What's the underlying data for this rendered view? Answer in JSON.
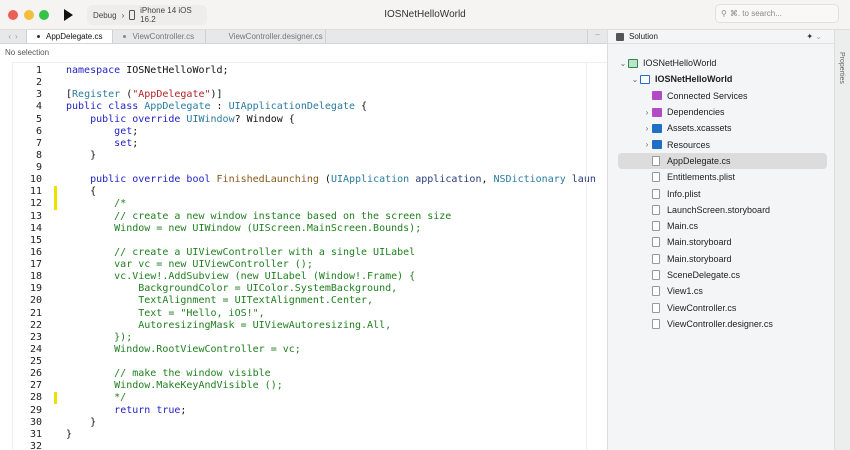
{
  "toolbar": {
    "config": "Debug",
    "separator": "›",
    "device": "iPhone 14 iOS 16.2",
    "title": "IOSNetHelloWorld",
    "search_placeholder": "⌘. to search..."
  },
  "tabs": [
    {
      "label": "AppDelegate.cs",
      "active": true,
      "modified": true
    },
    {
      "label": "ViewController.cs",
      "active": false,
      "modified": true
    },
    {
      "label": "ViewController.designer.cs",
      "active": false,
      "modified": false
    }
  ],
  "editor": {
    "selection_status": "No selection",
    "marked_lines": [
      11,
      12,
      28
    ],
    "lines": [
      [
        [
          "kw",
          "namespace "
        ],
        [
          "pl",
          "IOSNetHelloWorld;"
        ]
      ],
      [],
      [
        [
          "pl",
          "["
        ],
        [
          "ty",
          "Register"
        ],
        [
          "pl",
          " ("
        ],
        [
          "st",
          "\"AppDelegate\""
        ],
        [
          "pl",
          ")]"
        ]
      ],
      [
        [
          "kw",
          "public class "
        ],
        [
          "ty",
          "AppDelegate"
        ],
        [
          "pl",
          " : "
        ],
        [
          "ty",
          "UIApplicationDelegate"
        ],
        [
          "pl",
          " {"
        ]
      ],
      [
        [
          "pl",
          "    "
        ],
        [
          "kw",
          "public override "
        ],
        [
          "ty",
          "UIWindow"
        ],
        [
          "pl",
          "? Window {"
        ]
      ],
      [
        [
          "pl",
          "        "
        ],
        [
          "kw",
          "get"
        ],
        [
          "pl",
          ";"
        ]
      ],
      [
        [
          "pl",
          "        "
        ],
        [
          "kw",
          "set"
        ],
        [
          "pl",
          ";"
        ]
      ],
      [
        [
          "pl",
          "    }"
        ]
      ],
      [],
      [
        [
          "pl",
          "    "
        ],
        [
          "kw",
          "public override bool "
        ],
        [
          "me",
          "FinishedLaunching"
        ],
        [
          "pl",
          " ("
        ],
        [
          "ty",
          "UIApplication"
        ],
        [
          "pa",
          " application"
        ],
        [
          "pl",
          ", "
        ],
        [
          "ty",
          "NSDictionary"
        ],
        [
          "pa",
          " laun"
        ]
      ],
      [
        [
          "pl",
          "    {"
        ]
      ],
      [
        [
          "cm",
          "        /*"
        ]
      ],
      [
        [
          "cm",
          "        // create a new window instance based on the screen size"
        ]
      ],
      [
        [
          "cm",
          "        Window = new UIWindow (UIScreen.MainScreen.Bounds);"
        ]
      ],
      [],
      [
        [
          "cm",
          "        // create a UIViewController with a single UILabel"
        ]
      ],
      [
        [
          "cm",
          "        var vc = new UIViewController ();"
        ]
      ],
      [
        [
          "cm",
          "        vc.View!.AddSubview (new UILabel (Window!.Frame) {"
        ]
      ],
      [
        [
          "cm",
          "            BackgroundColor = UIColor.SystemBackground,"
        ]
      ],
      [
        [
          "cm",
          "            TextAlignment = UITextAlignment.Center,"
        ]
      ],
      [
        [
          "cm",
          "            Text = \"Hello, iOS!\","
        ]
      ],
      [
        [
          "cm",
          "            AutoresizingMask = UIViewAutoresizing.All,"
        ]
      ],
      [
        [
          "cm",
          "        });"
        ]
      ],
      [
        [
          "cm",
          "        Window.RootViewController = vc;"
        ]
      ],
      [],
      [
        [
          "cm",
          "        // make the window visible"
        ]
      ],
      [
        [
          "cm",
          "        Window.MakeKeyAndVisible ();"
        ]
      ],
      [
        [
          "cm",
          "        */"
        ]
      ],
      [
        [
          "pl",
          "        "
        ],
        [
          "kw",
          "return true"
        ],
        [
          "pl",
          ";"
        ]
      ],
      [
        [
          "pl",
          "    }"
        ]
      ],
      [
        [
          "pl",
          "}"
        ]
      ],
      []
    ]
  },
  "solution": {
    "title": "Solution",
    "properties_label": "Properties",
    "items": [
      {
        "label": "IOSNetHelloWorld",
        "level": 0,
        "chevron": "⌄",
        "icon": "solution-icon"
      },
      {
        "label": "IOSNetHelloWorld",
        "level": 1,
        "chevron": "⌄",
        "icon": "project-icon",
        "bold": true
      },
      {
        "label": "Connected Services",
        "level": 2,
        "chevron": "",
        "icon": "connected-services-icon"
      },
      {
        "label": "Dependencies",
        "level": 2,
        "chevron": "›",
        "icon": "dependencies-folder-icon"
      },
      {
        "label": "Assets.xcassets",
        "level": 2,
        "chevron": "›",
        "icon": "folder-icon"
      },
      {
        "label": "Resources",
        "level": 2,
        "chevron": "›",
        "icon": "folder-icon"
      },
      {
        "label": "AppDelegate.cs",
        "level": 2,
        "chevron": "",
        "icon": "file-icon",
        "selected": true
      },
      {
        "label": "Entitlements.plist",
        "level": 2,
        "chevron": "",
        "icon": "file-icon"
      },
      {
        "label": "Info.plist",
        "level": 2,
        "chevron": "",
        "icon": "file-icon"
      },
      {
        "label": "LaunchScreen.storyboard",
        "level": 2,
        "chevron": "",
        "icon": "file-icon"
      },
      {
        "label": "Main.cs",
        "level": 2,
        "chevron": "",
        "icon": "file-icon"
      },
      {
        "label": "Main.storyboard",
        "level": 2,
        "chevron": "",
        "icon": "file-icon"
      },
      {
        "label": "Main.storyboard",
        "level": 2,
        "chevron": "",
        "icon": "file-icon"
      },
      {
        "label": "SceneDelegate.cs",
        "level": 2,
        "chevron": "",
        "icon": "file-icon"
      },
      {
        "label": "View1.cs",
        "level": 2,
        "chevron": "",
        "icon": "file-icon"
      },
      {
        "label": "ViewController.cs",
        "level": 2,
        "chevron": "",
        "icon": "file-icon"
      },
      {
        "label": "ViewController.designer.cs",
        "level": 2,
        "chevron": "",
        "icon": "file-icon"
      }
    ]
  }
}
